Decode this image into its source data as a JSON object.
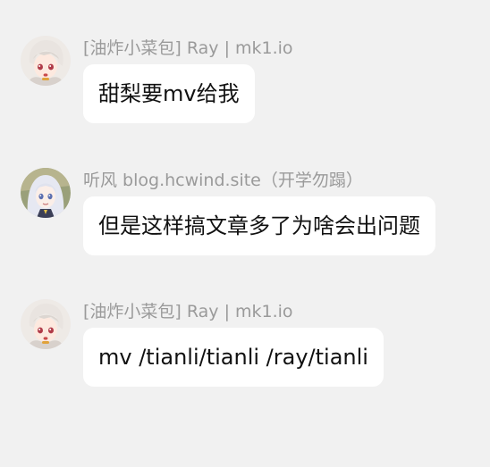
{
  "messages": [
    {
      "sender": "[油炸小菜包] Ray | mk1.io",
      "text": "甜梨要mv给我",
      "avatar_icon": "anime-girl-white-hair-avatar"
    },
    {
      "sender": "听风 blog.hcwind.site（开学勿蹋）",
      "text": "但是这样搞文章多了为啥会出问题",
      "avatar_icon": "anime-girl-silver-hair-avatar"
    },
    {
      "sender": "[油炸小菜包] Ray | mk1.io",
      "text": "mv /tianli/tianli /ray/tianli",
      "avatar_icon": "anime-girl-white-hair-avatar"
    }
  ],
  "colors": {
    "background": "#f1f1f1",
    "bubble": "#ffffff",
    "sender_text": "#9a9a9a",
    "message_text": "#111111"
  }
}
